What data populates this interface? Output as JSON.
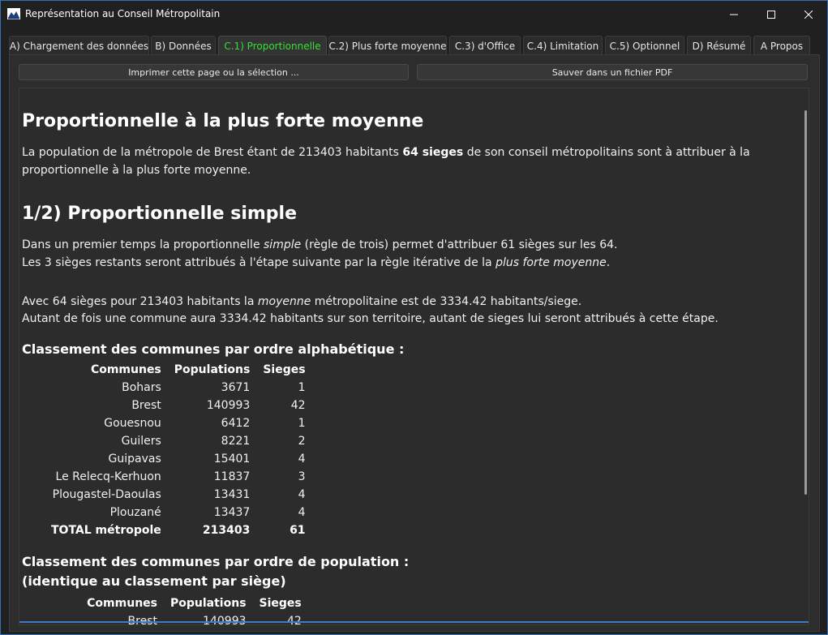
{
  "window": {
    "title": "Représentation au Conseil Métropolitain"
  },
  "tabs": [
    {
      "label": "A) Chargement des données",
      "active": false
    },
    {
      "label": "B) Données",
      "active": false
    },
    {
      "label": "C.1) Proportionnelle",
      "active": true
    },
    {
      "label": "C.2) Plus forte moyenne",
      "active": false
    },
    {
      "label": "C.3) d'Office",
      "active": false
    },
    {
      "label": "C.4) Limitation",
      "active": false
    },
    {
      "label": "C.5) Optionnel",
      "active": false
    },
    {
      "label": "D) Résumé",
      "active": false
    },
    {
      "label": "A Propos",
      "active": false
    }
  ],
  "toolbar": {
    "print_label": "Imprimer cette page ou la sélection ...",
    "pdf_label": "Sauver dans un fichier PDF"
  },
  "content": {
    "heading1": "Proportionnelle à la plus forte moyenne",
    "intro": {
      "before": "La population de la métropole de Brest étant de 213403 habitants ",
      "bold": "64 sieges",
      "after": " de son conseil métropolitains sont à attribuer à la proportionnelle à la plus forte moyenne."
    },
    "heading2": "1/2) Proportionnelle simple",
    "line1": {
      "before": "Dans un premier temps la proportionnelle ",
      "italic": "simple",
      "after": " (règle de trois) permet d'attribuer 61 sièges sur les 64."
    },
    "line2": {
      "before": "Les 3 sièges restants seront attribués à l'étape suivante par la règle itérative de la ",
      "italic": "plus forte moyenne",
      "after": "."
    },
    "line3": {
      "before": "Avec 64 sièges pour 213403 habitants la ",
      "italic": "moyenne",
      "after": " métropolitaine est de 3334.42 habitants/siege."
    },
    "line4": "Autant de fois une commune aura 3334.42 habitants sur son territoire, autant de sieges lui seront attribués à cette étape.",
    "alpha_title": "Classement des communes par ordre alphabétique :",
    "columns": [
      "Communes",
      "Populations",
      "Sieges"
    ],
    "alpha_rows": [
      [
        "Bohars",
        "3671",
        "1"
      ],
      [
        "Brest",
        "140993",
        "42"
      ],
      [
        "Gouesnou",
        "6412",
        "1"
      ],
      [
        "Guilers",
        "8221",
        "2"
      ],
      [
        "Guipavas",
        "15401",
        "4"
      ],
      [
        "Le Relecq-Kerhuon",
        "11837",
        "3"
      ],
      [
        "Plougastel-Daoulas",
        "13431",
        "4"
      ],
      [
        "Plouzané",
        "13437",
        "4"
      ]
    ],
    "alpha_total": [
      "TOTAL métropole",
      "213403",
      "61"
    ],
    "pop_title_1": "Classement des communes par ordre de population :",
    "pop_title_2": "(identique au classement par siège)",
    "pop_rows": [
      [
        "Brest",
        "140993",
        "42"
      ]
    ]
  },
  "colors": {
    "active_tab": "#35e035",
    "accent": "#3f7bbd"
  }
}
